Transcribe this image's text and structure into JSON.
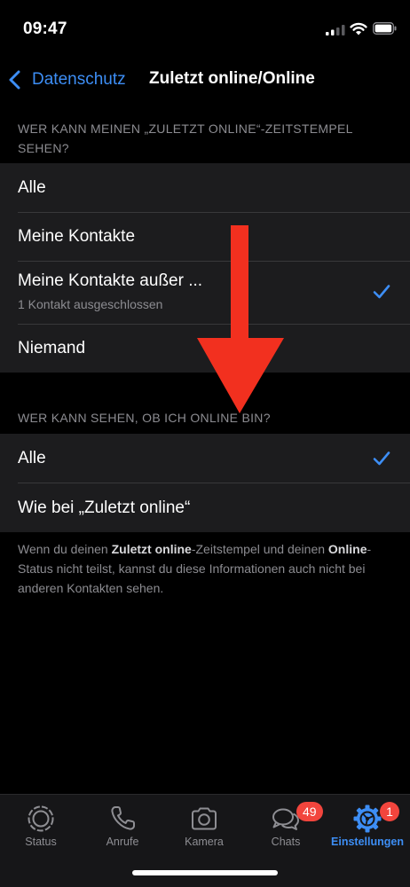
{
  "status_bar": {
    "time": "09:47"
  },
  "nav": {
    "back_label": "Datenschutz",
    "title": "Zuletzt online/Online"
  },
  "section1": {
    "header": "WER KANN MEINEN „ZULETZT ONLINE“-ZEITSTEMPEL SEHEN?",
    "options": [
      {
        "label": "Alle",
        "sub": "",
        "checked": false
      },
      {
        "label": "Meine Kontakte",
        "sub": "",
        "checked": false
      },
      {
        "label": "Meine Kontakte außer ...",
        "sub": "1 Kontakt ausgeschlossen",
        "checked": true
      },
      {
        "label": "Niemand",
        "sub": "",
        "checked": false
      }
    ]
  },
  "section2": {
    "header": "WER KANN SEHEN, OB ICH ONLINE BIN?",
    "options": [
      {
        "label": "Alle",
        "checked": true
      },
      {
        "label": "Wie bei „Zuletzt online“",
        "checked": false
      }
    ]
  },
  "footer_note": {
    "p1": "Wenn du deinen ",
    "b1": "Zuletzt online",
    "p2": "-Zeitstempel und deinen ",
    "b2": "Online",
    "p3": "-Status nicht teilst, kannst du diese Informationen auch nicht bei anderen Kontakten sehen."
  },
  "tabbar": {
    "tabs": [
      {
        "label": "Status",
        "icon": "status-icon",
        "badge": ""
      },
      {
        "label": "Anrufe",
        "icon": "phone-icon",
        "badge": ""
      },
      {
        "label": "Kamera",
        "icon": "camera-icon",
        "badge": ""
      },
      {
        "label": "Chats",
        "icon": "chat-bubbles-icon",
        "badge": "49"
      },
      {
        "label": "Einstellungen",
        "icon": "settings-gear-icon",
        "badge": "1"
      }
    ],
    "active": "Einstellungen"
  },
  "colors": {
    "accent": "#3d8ef5",
    "badge": "#f2453d",
    "annotation_arrow": "#f2301f",
    "cell_bg": "#1c1c1e"
  }
}
